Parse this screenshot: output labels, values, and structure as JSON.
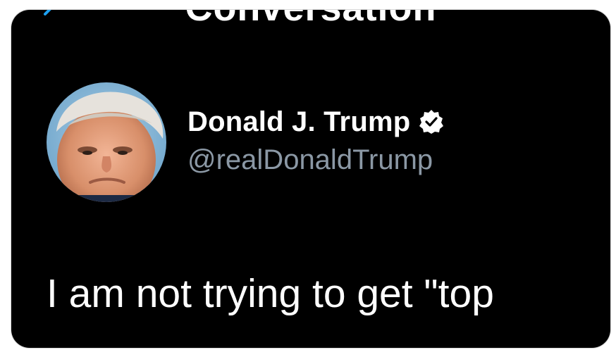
{
  "header": {
    "title": "Conversation",
    "back_icon": "back-arrow-icon"
  },
  "tweet": {
    "author": {
      "display_name": "Donald J. Trump",
      "handle": "@realDonaldTrump",
      "verified_icon": "verified-badge-icon",
      "avatar_icon": "profile-avatar"
    },
    "text_line_1": "I am not trying to get \"top",
    "text_line_2": ""
  },
  "colors": {
    "background": "#000000",
    "text": "#ffffff",
    "handle": "#8b98a5",
    "accent": "#1da1f2"
  }
}
